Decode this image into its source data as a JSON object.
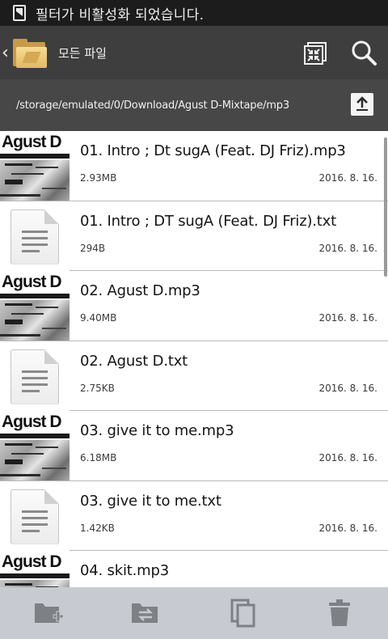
{
  "status_bar": {
    "notification": "필터가 비활성화 되었습니다."
  },
  "app_bar": {
    "title": "모든 파일",
    "icons": [
      "back-icon",
      "folder-icon",
      "collapse-icon",
      "search-icon"
    ]
  },
  "path_bar": {
    "path": "/storage/emulated/0/Download/Agust D-Mixtape/mp3",
    "icon": "up-arrow-icon"
  },
  "album_art": {
    "title": "Agust D"
  },
  "files": [
    {
      "name": "01. Intro ; Dt sugA (Feat. DJ Friz).mp3",
      "size": "2.93MB",
      "date": "2016. 8. 16.",
      "kind": "album-thumbnail"
    },
    {
      "name": "01. Intro ; DT sugA (Feat. DJ Friz).txt",
      "size": "294B",
      "date": "2016. 8. 16.",
      "kind": "document-icon"
    },
    {
      "name": "02. Agust D.mp3",
      "size": "9.40MB",
      "date": "2016. 8. 16.",
      "kind": "album-thumbnail"
    },
    {
      "name": "02. Agust D.txt",
      "size": "2.75KB",
      "date": "2016. 8. 16.",
      "kind": "document-icon"
    },
    {
      "name": "03. give it to me.mp3",
      "size": "6.18MB",
      "date": "2016. 8. 16.",
      "kind": "album-thumbnail"
    },
    {
      "name": "03. give it to me.txt",
      "size": "1.42KB",
      "date": "2016. 8. 16.",
      "kind": "document-icon"
    },
    {
      "name": "04. skit.mp3",
      "size": "",
      "date": "",
      "kind": "album-thumbnail"
    }
  ],
  "bottom_bar": {
    "icons": [
      "new-folder-icon",
      "move-icon",
      "copy-icon",
      "delete-icon"
    ]
  },
  "colors": {
    "status_bar": "#1c1c1c",
    "app_bar": "#3e3e3e",
    "path_bar": "#474747",
    "bottom_bar": "#c7cbd1",
    "divider": "#b9b9b9"
  }
}
